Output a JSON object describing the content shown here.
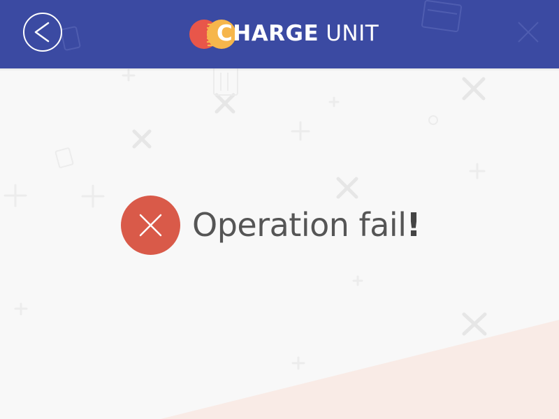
{
  "header": {
    "brand_bold": "CHARGE",
    "brand_light": "UNIT",
    "back_icon": "back-chevron-icon"
  },
  "status": {
    "message": "Operation fail",
    "emphasis": "!",
    "icon": "error-x-icon"
  },
  "colors": {
    "header_bg": "#3b4aa2",
    "error": "#d95a49",
    "brand_red": "#e8564a",
    "brand_yellow": "#f6b64c",
    "text": "#555555",
    "background": "#f8f8f8",
    "corner_accent": "#f9ebe6"
  }
}
